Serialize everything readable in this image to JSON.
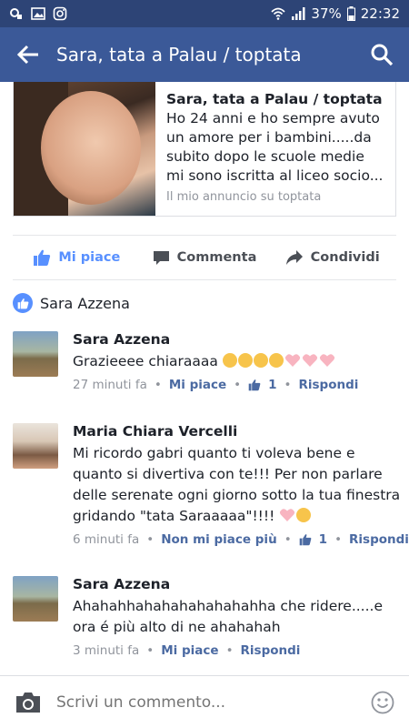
{
  "status_bar": {
    "battery": "37%",
    "time": "22:32"
  },
  "app_bar": {
    "title": "Sara, tata a Palau / toptata"
  },
  "card": {
    "title": "Sara, tata a Palau / toptata",
    "description": "Ho 24 anni e ho sempre avuto un amore per i bambini.....da subito dopo le scuole medie mi sono iscritta al liceo socio...",
    "source": "Il mio annuncio su toptata"
  },
  "actions": {
    "like": "Mi piace",
    "comment": "Commenta",
    "share": "Condividi"
  },
  "likers": {
    "text": "Sara Azzena"
  },
  "comments": [
    {
      "name": "Sara Azzena",
      "text": "Grazieeee chiaraaaa",
      "emojis": [
        "kiss-emoji",
        "kiss-emoji",
        "kiss-emoji",
        "kiss-emoji",
        "pink-heart-emoji",
        "pink-heart-emoji",
        "pink-heart-emoji"
      ],
      "time": "27 minuti fa",
      "like_label": "Mi piace",
      "like_count": "1",
      "reply": "Rispondi"
    },
    {
      "name": "Maria Chiara Vercelli",
      "text": "Mi ricordo gabri quanto ti voleva bene e quanto si divertiva con te!!! Per non parlare delle serenate ogni giorno sotto la tua finestra gridando \"tata Saraaaaa\"!!!!",
      "emojis": [
        "pink-heart-emoji",
        "heart-eyes-emoji"
      ],
      "time": "6 minuti fa",
      "like_label": "Non mi piace più",
      "like_count": "1",
      "reply": "Rispondi"
    },
    {
      "name": "Sara Azzena",
      "text": "Ahahahhahahahahahahahha che ridere.....e ora é più alto di ne ahahahah",
      "time": "3 minuti fa",
      "like_label": "Mi piace",
      "reply": "Rispondi"
    }
  ],
  "composer": {
    "placeholder": "Scrivi un commento..."
  },
  "colors": {
    "brand": "#3b5998",
    "status_bar": "#2d4476",
    "like_blue": "#5890ff",
    "meta_link": "#4b6aa2"
  }
}
